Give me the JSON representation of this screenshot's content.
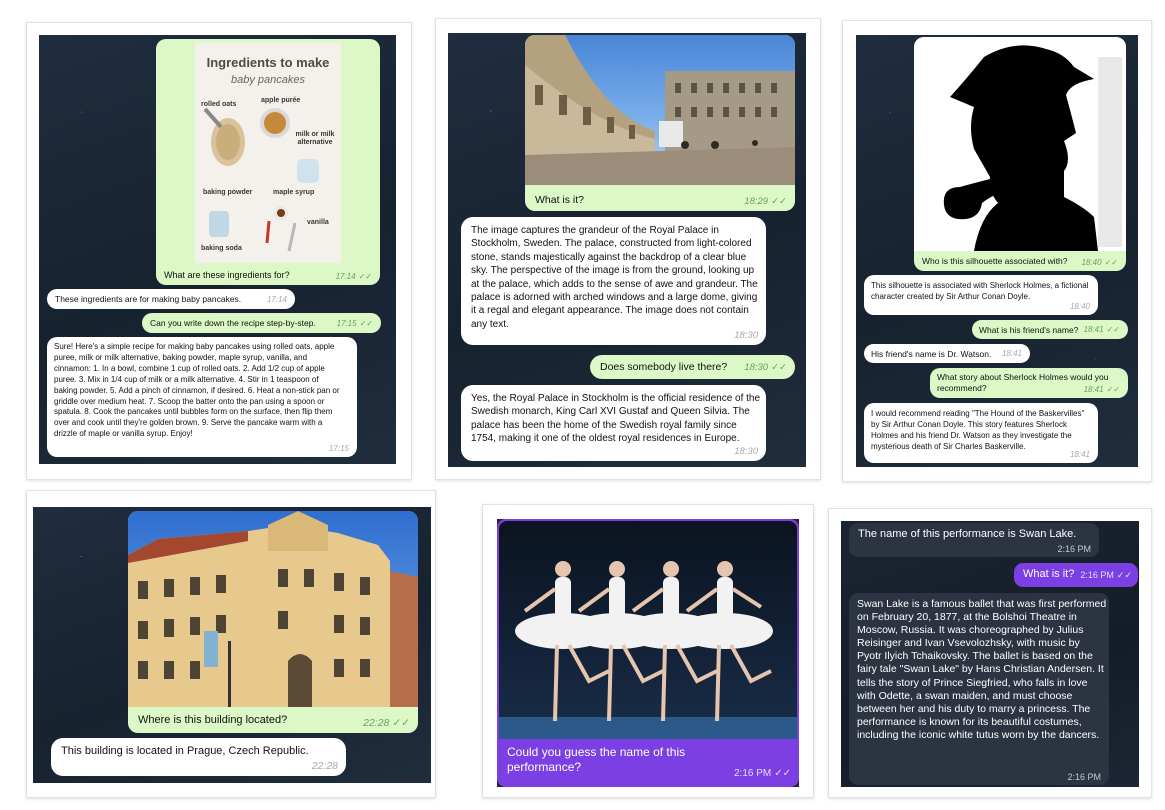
{
  "panel1": {
    "image_title": "Ingredients to make",
    "image_subtitle": "baby pancakes",
    "ingredient_labels": [
      "rolled oats",
      "apple purée",
      "milk or milk alternative",
      "baking powder",
      "maple syrup",
      "vanilla",
      "baking soda"
    ],
    "messages": [
      {
        "text": "What are these ingredients for?",
        "time": "17:14"
      },
      {
        "text": "These ingredients are for making baby pancakes.",
        "time": "17:14"
      },
      {
        "text": "Can you write down the recipe step-by-step.",
        "time": "17:15"
      },
      {
        "text": "Sure! Here's a simple recipe for making baby pancakes using rolled oats, apple puree, milk or milk alternative, baking powder, maple syrup, vanilla, and cinnamon: 1. In a bowl, combine 1 cup of rolled oats. 2. Add 1/2 cup of apple puree. 3. Mix in 1/4 cup of milk or a milk alternative. 4. Stir in 1 teaspoon of baking powder. 5. Add a pinch of cinnamon, if desired. 6. Heat a non-stick pan or griddle over medium heat. 7. Scoop the batter onto the pan using a spoon or spatula. 8. Cook the pancakes until bubbles form on the surface, then flip them over and cook until they're golden brown. 9. Serve the pancake warm with a drizzle of maple or vanilla syrup. Enjoy!",
        "time": "17:15"
      }
    ]
  },
  "panel2": {
    "messages": [
      {
        "text": "What is it?",
        "time": "18:29"
      },
      {
        "text": "The image captures the grandeur of the Royal Palace in Stockholm, Sweden. The palace, constructed from light-colored stone, stands majestically against the backdrop of a clear blue sky. The perspective of the image is from the ground, looking up at the palace, which adds to the sense of awe and grandeur. The palace is adorned with arched windows and a large dome, giving it a regal and elegant appearance. The image does not contain any text.",
        "time": "18:30"
      },
      {
        "text": "Does somebody live there?",
        "time": "18:30"
      },
      {
        "text": "Yes, the Royal Palace in Stockholm is the official residence of the Swedish monarch, King Carl XVI Gustaf and Queen Silvia. The palace has been the home of the Swedish royal family since 1754, making it one of the oldest royal residences in Europe.",
        "time": "18:30"
      }
    ]
  },
  "panel3": {
    "messages": [
      {
        "text": "Who is this silhouette associated with?",
        "time": "18:40"
      },
      {
        "text": "This silhouette is associated with Sherlock Holmes, a fictional character created by Sir Arthur Conan Doyle.",
        "time": "18:40"
      },
      {
        "text": "What is his friend's name?",
        "time": "18:41"
      },
      {
        "text": "His friend's name is Dr. Watson.",
        "time": "18:41"
      },
      {
        "text": "What story about Sherlock Holmes would you recommend?",
        "time": "18:41"
      },
      {
        "text": "I would recommend reading \"The Hound of the Baskervilles\" by Sir Arthur Conan Doyle. This story features Sherlock Holmes and his friend Dr. Watson as they investigate the mysterious death of Sir Charles Baskerville.",
        "time": "18:41"
      }
    ]
  },
  "panel4": {
    "messages": [
      {
        "text": "Where is this building located?",
        "time": "22:28"
      },
      {
        "text": "This building is located in Prague, Czech Republic.",
        "time": "22:28"
      }
    ]
  },
  "panel5": {
    "messages": [
      {
        "text": "Could you guess the name of this performance?",
        "time": "2:16 PM"
      }
    ]
  },
  "panel6": {
    "messages": [
      {
        "text": "The name of this performance is Swan Lake.",
        "time": "2:16 PM"
      },
      {
        "text": "What is it?",
        "time": "2:16 PM"
      },
      {
        "text": "Swan Lake is a famous ballet that was first performed on February 20, 1877, at the Bolshoi Theatre in Moscow, Russia. It was choreographed by Julius Reisinger and Ivan Vsevolozhsky, with music by Pyotr Ilyich Tchaikovsky. The ballet is based on the fairy tale \"Swan Lake\" by Hans Christian Andersen. It tells the story of Prince Siegfried, who falls in love with Odette, a swan maiden, and must choose between her and his duty to marry a princess. The performance is known for its beautiful costumes, including the iconic white tutus worn by the dancers.",
        "time": "2:16 PM"
      }
    ]
  },
  "icons": {
    "read_ticks": "double-check-icon"
  },
  "colors": {
    "outgoing_bubble": "#dcf8c6",
    "incoming_bubble": "#ffffff",
    "chat_background": "#1f2d3f",
    "telegram_outgoing": "#7b3fe4",
    "telegram_incoming": "#2b3440"
  }
}
